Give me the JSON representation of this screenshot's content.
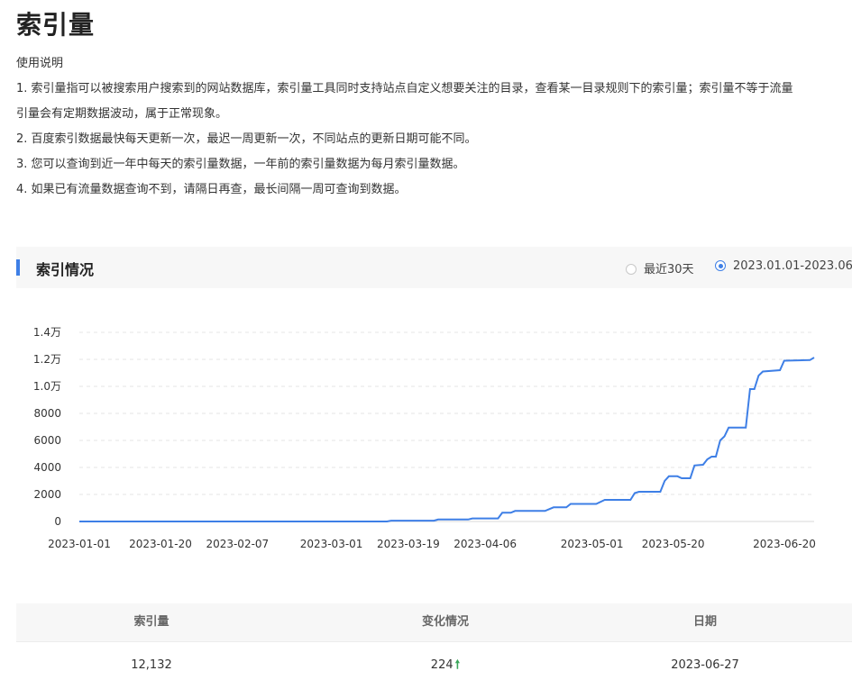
{
  "page": {
    "title": "索引量"
  },
  "usage": {
    "heading": "使用说明",
    "lines": [
      "1. 索引量指可以被搜索用户搜索到的网站数据库，索引量工具同时支持站点自定义想要关注的目录，查看某一目录规则下的索引量；索引量不等于流量",
      "引量会有定期数据波动，属于正常现象。",
      "2. 百度索引数据最快每天更新一次，最迟一周更新一次，不同站点的更新日期可能不同。",
      "3. 您可以查询到近一年中每天的索引量数据，一年前的索引量数据为每月索引量数据。",
      "4. 如果已有流量数据查询不到，请隔日再查，最长间隔一周可查询到数据。"
    ]
  },
  "section": {
    "title": "索引情况",
    "options": [
      {
        "label": "最近30天",
        "checked": false
      },
      {
        "label": "2023.01.01-2023.06.",
        "checked": true
      }
    ]
  },
  "chart_data": {
    "type": "line",
    "y_tick_labels": [
      "0",
      "2000",
      "4000",
      "6000",
      "8000",
      "1.0万",
      "1.2万",
      "1.4万"
    ],
    "y_ticks": [
      0,
      2000,
      4000,
      6000,
      8000,
      10000,
      12000,
      14000
    ],
    "ylim": [
      0,
      14000
    ],
    "x_tick_labels": [
      "2023-01-01",
      "2023-01-20",
      "2023-02-07",
      "2023-03-01",
      "2023-03-19",
      "2023-04-06",
      "2023-05-01",
      "2023-05-20",
      "2023-06-20"
    ],
    "grid": true,
    "line_color": "#3e7fe6",
    "series": [
      {
        "points": [
          [
            "2023-01-01",
            0
          ],
          [
            "2023-03-14",
            0
          ],
          [
            "2023-03-15",
            60
          ],
          [
            "2023-03-25",
            60
          ],
          [
            "2023-03-26",
            150
          ],
          [
            "2023-04-02",
            150
          ],
          [
            "2023-04-03",
            230
          ],
          [
            "2023-04-09",
            230
          ],
          [
            "2023-04-10",
            650
          ],
          [
            "2023-04-12",
            650
          ],
          [
            "2023-04-13",
            780
          ],
          [
            "2023-04-20",
            780
          ],
          [
            "2023-04-22",
            1050
          ],
          [
            "2023-04-25",
            1050
          ],
          [
            "2023-04-26",
            1300
          ],
          [
            "2023-05-02",
            1300
          ],
          [
            "2023-05-04",
            1600
          ],
          [
            "2023-05-10",
            1600
          ],
          [
            "2023-05-11",
            2100
          ],
          [
            "2023-05-12",
            2200
          ],
          [
            "2023-05-17",
            2200
          ],
          [
            "2023-05-18",
            3000
          ],
          [
            "2023-05-19",
            3350
          ],
          [
            "2023-05-21",
            3350
          ],
          [
            "2023-05-22",
            3200
          ],
          [
            "2023-05-24",
            3200
          ],
          [
            "2023-05-25",
            4150
          ],
          [
            "2023-05-27",
            4200
          ],
          [
            "2023-05-28",
            4600
          ],
          [
            "2023-05-29",
            4800
          ],
          [
            "2023-05-30",
            4800
          ],
          [
            "2023-05-31",
            6000
          ],
          [
            "2023-06-01",
            6300
          ],
          [
            "2023-06-02",
            6950
          ],
          [
            "2023-06-06",
            6950
          ],
          [
            "2023-06-07",
            9800
          ],
          [
            "2023-06-08",
            9800
          ],
          [
            "2023-06-09",
            10800
          ],
          [
            "2023-06-10",
            11100
          ],
          [
            "2023-06-14",
            11200
          ],
          [
            "2023-06-15",
            11900
          ],
          [
            "2023-06-21",
            11950
          ],
          [
            "2023-06-22",
            12132
          ]
        ]
      }
    ]
  },
  "table": {
    "headers": [
      "索引量",
      "变化情况",
      "日期"
    ],
    "rows": [
      {
        "index": "12,132",
        "change": "224",
        "arrow": "🠕",
        "date": "2023-06-27"
      }
    ]
  }
}
